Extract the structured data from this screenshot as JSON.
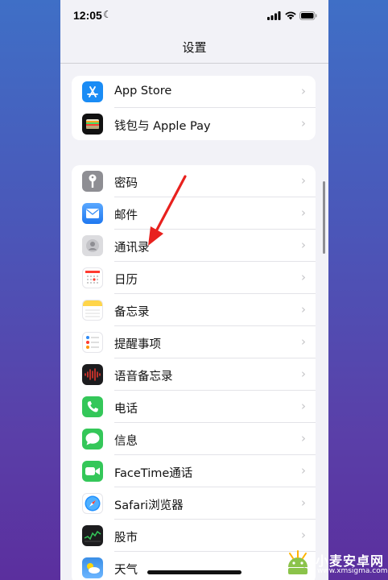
{
  "status": {
    "time": "12:05",
    "moon": "☾"
  },
  "nav": {
    "title": "设置"
  },
  "groups": [
    {
      "items": [
        {
          "label": "App Store",
          "icon": "app-store-icon",
          "color": "#1a8cf5"
        },
        {
          "label": "钱包与 Apple Pay",
          "icon": "wallet-icon",
          "color": "#111111"
        }
      ]
    },
    {
      "items": [
        {
          "label": "密码",
          "icon": "key-icon",
          "color": "#8e8e93"
        },
        {
          "label": "邮件",
          "icon": "mail-icon",
          "color": "#2f8af5"
        },
        {
          "label": "通讯录",
          "icon": "contacts-icon",
          "color": "#d8d8dc"
        },
        {
          "label": "日历",
          "icon": "calendar-icon",
          "color": "#ffffff"
        },
        {
          "label": "备忘录",
          "icon": "notes-icon",
          "color": "#ffd54a"
        },
        {
          "label": "提醒事项",
          "icon": "reminders-icon",
          "color": "#ffffff"
        },
        {
          "label": "语音备忘录",
          "icon": "voice-memos-icon",
          "color": "#1c1c1e"
        },
        {
          "label": "电话",
          "icon": "phone-icon",
          "color": "#34c759"
        },
        {
          "label": "信息",
          "icon": "messages-icon",
          "color": "#34c759"
        },
        {
          "label": "FaceTime通话",
          "icon": "facetime-icon",
          "color": "#34c759"
        },
        {
          "label": "Safari浏览器",
          "icon": "safari-icon",
          "color": "#ffffff"
        },
        {
          "label": "股市",
          "icon": "stocks-icon",
          "color": "#1c1c1e"
        },
        {
          "label": "天气",
          "icon": "weather-icon",
          "color": "#3a8ee6"
        }
      ]
    }
  ],
  "watermark": {
    "name": "小麦安卓网",
    "url": "www.xmsigma.com"
  }
}
